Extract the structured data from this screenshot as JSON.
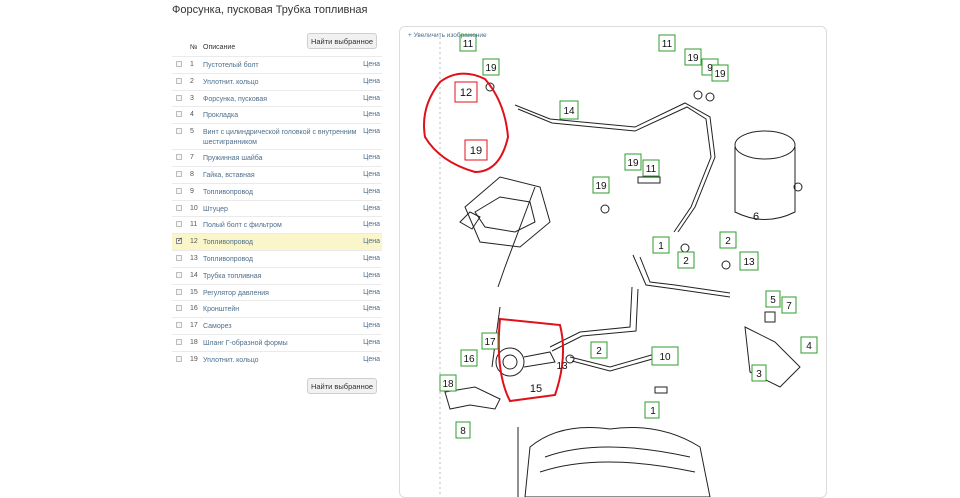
{
  "page": {
    "title": "Форсунка, пусковая Трубка топливная"
  },
  "buttons": {
    "find_selected_top": "Найти выбранное",
    "find_selected_bottom": "Найти выбранное"
  },
  "table": {
    "headers": {
      "num": "№",
      "desc": "Описание"
    },
    "rows": [
      {
        "num": "1",
        "desc": "Пустотелый болт",
        "price": "Цена",
        "checked": false
      },
      {
        "num": "2",
        "desc": "Уплотнит. кольцо",
        "price": "Цена",
        "checked": false
      },
      {
        "num": "3",
        "desc": "Форсунка, пусковая",
        "price": "Цена",
        "checked": false
      },
      {
        "num": "4",
        "desc": "Прокладка",
        "price": "Цена",
        "checked": false
      },
      {
        "num": "5",
        "desc": "Винт с цилиндрической головкой с внутренним шестигранником",
        "price": "Цена",
        "checked": false
      },
      {
        "num": "7",
        "desc": "Пружинная шайба",
        "price": "Цена",
        "checked": false
      },
      {
        "num": "8",
        "desc": "Гайка, вставная",
        "price": "Цена",
        "checked": false
      },
      {
        "num": "9",
        "desc": "Топливопровод",
        "price": "Цена",
        "checked": false
      },
      {
        "num": "10",
        "desc": "Штуцер",
        "price": "Цена",
        "checked": false
      },
      {
        "num": "11",
        "desc": "Полый болт с фильтром",
        "price": "Цена",
        "checked": false
      },
      {
        "num": "12",
        "desc": "Топливопровод",
        "price": "Цена",
        "checked": true
      },
      {
        "num": "13",
        "desc": "Топливопровод",
        "price": "Цена",
        "checked": false
      },
      {
        "num": "14",
        "desc": "Трубка топливная",
        "price": "Цена",
        "checked": false
      },
      {
        "num": "15",
        "desc": "Регулятор давления",
        "price": "Цена",
        "checked": false
      },
      {
        "num": "16",
        "desc": "Кронштейн",
        "price": "Цена",
        "checked": false
      },
      {
        "num": "17",
        "desc": "Саморез",
        "price": "Цена",
        "checked": false
      },
      {
        "num": "18",
        "desc": "Шланг Г-образной формы",
        "price": "Цена",
        "checked": false
      },
      {
        "num": "19",
        "desc": "Уплотнит. кольцо",
        "price": "Цена",
        "checked": false
      }
    ]
  },
  "diagram": {
    "zoom_link": "+ Увеличить изображение",
    "callouts": [
      "11",
      "19",
      "12",
      "19",
      "14",
      "11",
      "19",
      "9",
      "19",
      "19",
      "11",
      "19",
      "6",
      "1",
      "2",
      "2",
      "13",
      "5",
      "7",
      "17",
      "16",
      "2",
      "10",
      "4",
      "3",
      "18",
      "8",
      "15",
      "13"
    ],
    "colors": {
      "callout_border": "#2e9e2e",
      "highlight": "#e0101a"
    }
  }
}
